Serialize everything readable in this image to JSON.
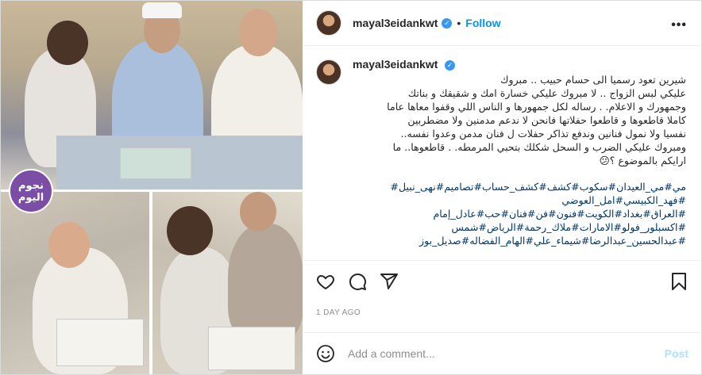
{
  "post": {
    "username": "mayal3eidankwt",
    "verified_mark": "✓",
    "follow_label": "Follow",
    "more_label": "•••",
    "caption_lines": "شيرين تعود رسميا الى حسام حبيب .. مبروك\nعليكي لبس الزواج .. لا مبروك عليكي خسارة امك و شقيقك و بناتك\nوجمهورك و الاعلام. . رساله لكل جمهورها و الناس اللي وقفوا معاها عاما\nكاملا قاطعوها و قاطعوا حفلاتها فانحن لا ندعم مدمنين ولا مضطربين\nنفسيا ولا نمول فنانين وندفع تذاكر حفلات ل فنان مدمن وعدوا نفسه..\nومبروك عليكي الضرب و السحل شكلك بتحبي المرمطه. . قاطعوها.. ما\nارايكم بالموضوع ؟😕",
    "hashtags": "مي#مي_العيدان#سكوب#كشف#كشف_حساب#تصاميم#نهى_نبيل#\n#فهد_الكبيسي#امل_العوضي\n#العراق#بغداد#الكويت#فنون#فن#فنان#حب#عادل_إمام\n#اكسبلور_فولو#الامارات#ملاك_رحمة#الرياض#شمس\n#عبدالحسين_عبدالرضا#شيماء_علي#الهام_الفضاله#صديل_بوز",
    "time": "1 DAY AGO",
    "comment_placeholder": "Add a comment...",
    "post_label": "Post"
  },
  "photo": {
    "badge_line1": "نجوم",
    "badge_line2": "اليوم",
    "badge_color": "#7b4ea6"
  },
  "icons": [
    "heart-icon",
    "comment-icon",
    "share-icon",
    "bookmark-icon",
    "emoji-icon"
  ],
  "colors": {
    "accent": "#0095f6",
    "hashtag": "#00376b",
    "muted": "#8e8e8e"
  }
}
